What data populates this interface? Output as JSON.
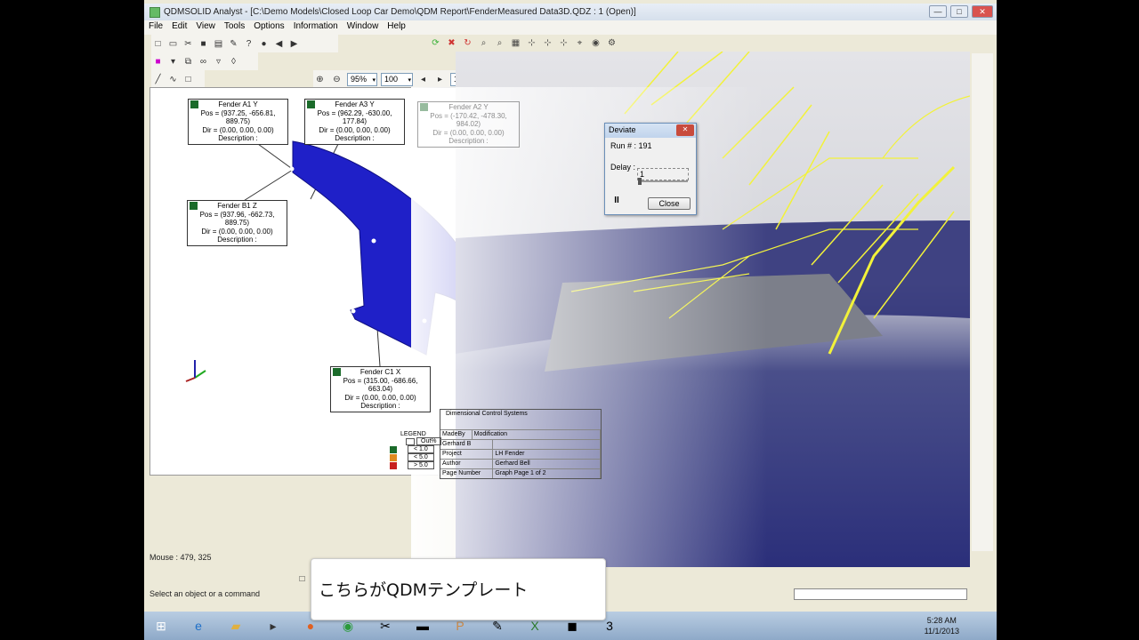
{
  "window": {
    "title": "QDMSOLID Analyst - [C:\\Demo Models\\Closed Loop Car Demo\\QDM Report\\FenderMeasured Data3D.QDZ : 1 (Open)]",
    "btn_min": "—",
    "btn_max": "□",
    "btn_close": "✕"
  },
  "menu": [
    "File",
    "Edit",
    "View",
    "Tools",
    "Options",
    "Information",
    "Window",
    "Help"
  ],
  "toolbar": {
    "zoom": "95%",
    "count": "100",
    "steps": "10"
  },
  "notes": [
    {
      "title": "Fender A1  Y",
      "pos": "Pos = (937.25, -656.81, 889.75)",
      "dir": "Dir = (0.00, 0.00, 0.00)",
      "desc": "Description :"
    },
    {
      "title": "Fender A3  Y",
      "pos": "Pos = (962.29, -630.00, 177.84)",
      "dir": "Dir = (0.00, 0.00, 0.00)",
      "desc": "Description :"
    },
    {
      "title": "Fender A2  Y",
      "pos": "Pos = (-170.42, -478.30, 984.02)",
      "dir": "Dir = (0.00, 0.00, 0.00)",
      "desc": "Description :"
    },
    {
      "title": "Fender B1  Z",
      "pos": "Pos = (937.96, -662.73, 889.75)",
      "dir": "Dir = (0.00, 0.00, 0.00)",
      "desc": "Description :"
    },
    {
      "title": "Fender C1  X",
      "pos": "Pos = (315.00, -686.66, 663.04)",
      "dir": "Dir = (0.00, 0.00, 0.00)",
      "desc": "Description :"
    }
  ],
  "legend": {
    "title": "LEGEND",
    "rows": [
      {
        "label": "Out%",
        "color": "#ffffff"
      },
      {
        "label": "< 1.0",
        "color": "#1b6b2a"
      },
      {
        "label": "< 5.0",
        "color": "#e08a1e"
      },
      {
        "label": "> 5.0",
        "color": "#c8201e"
      }
    ]
  },
  "titleblock": {
    "head": "Dimensional Control Systems",
    "rows": [
      [
        "MadeBy",
        "Modification"
      ],
      [
        "Gerhard B",
        ""
      ],
      [
        "Project",
        "LH Fender"
      ],
      [
        "Author",
        "Gerhard Bell"
      ],
      [
        "Page Number",
        "Graph Page 1 of 2"
      ]
    ]
  },
  "dialog": {
    "title": "Deviate",
    "run": "Run # :  191",
    "delay_label": "Delay :",
    "delay_value": "1",
    "close": "Close",
    "pause": "II",
    "close_x": "✕"
  },
  "status": {
    "mouse": "Mouse : 479, 325",
    "prompt": "Select an object or a command"
  },
  "caption": "こちらがQDMテンプレート",
  "clock": {
    "time": "5:28 AM",
    "date": "11/1/2013"
  },
  "colors": {
    "part": "#1f20c8",
    "wire": "#f2f23a"
  }
}
